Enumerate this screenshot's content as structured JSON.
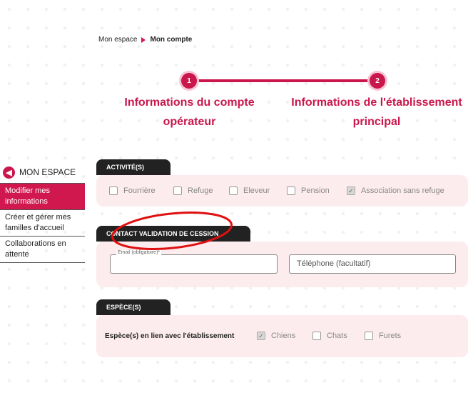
{
  "breadcrumb": {
    "home": "Mon espace",
    "current": "Mon compte"
  },
  "stepper": {
    "steps": [
      {
        "number": "1",
        "label": "Informations du compte opérateur"
      },
      {
        "number": "2",
        "label": "Informations de l'établissement principal"
      }
    ]
  },
  "sidebar": {
    "title": "MON ESPACE",
    "items": [
      {
        "label": "Modifier mes informations",
        "active": true
      },
      {
        "label": "Créer et gérer mes familles d'accueil",
        "active": false
      },
      {
        "label": "Collaborations en attente",
        "active": false
      }
    ]
  },
  "activites": {
    "title": "ACTIVITÉ(S)",
    "options": [
      {
        "label": "Fourrière",
        "checked": false
      },
      {
        "label": "Refuge",
        "checked": false
      },
      {
        "label": "Eleveur",
        "checked": false
      },
      {
        "label": "Pension",
        "checked": false
      },
      {
        "label": "Association sans refuge",
        "checked": true
      }
    ]
  },
  "contact": {
    "title": "CONTACT VALIDATION DE CESSION",
    "email_label": "Email (obligatoire)*",
    "email_value": "",
    "phone_placeholder": "Téléphone (facultatif)"
  },
  "especes": {
    "title": "ESPÈCE(S)",
    "row_label": "Espèce(s) en lien avec l'établissement",
    "options": [
      {
        "label": "Chiens",
        "checked": true
      },
      {
        "label": "Chats",
        "checked": false
      },
      {
        "label": "Furets",
        "checked": false
      }
    ]
  },
  "colors": {
    "accent": "#c9174c",
    "card_bg": "#fdecee",
    "annotation": "#e01010"
  }
}
